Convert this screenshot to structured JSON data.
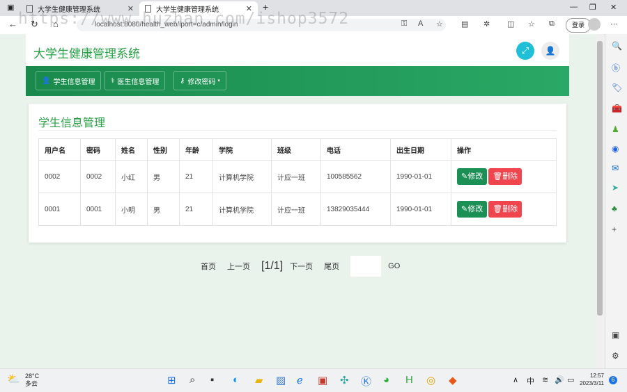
{
  "browser": {
    "tabs": [
      {
        "title": "大学生健康管理系统",
        "active": false
      },
      {
        "title": "大学生健康管理系统",
        "active": true
      }
    ],
    "new_tab": "+",
    "url": "localhost:8080/health_web/iport=c/admin/login",
    "login_label": "登录",
    "watermark": "https://www.huzhan.com/ishop3572"
  },
  "app": {
    "title": "大学生健康管理系统",
    "menu": [
      {
        "icon": "user-icon",
        "label": "学生信息管理"
      },
      {
        "icon": "doctor-icon",
        "label": "医生信息管理"
      },
      {
        "icon": "key-icon",
        "label": "修改密码"
      }
    ]
  },
  "main": {
    "section_title": "学生信息管理",
    "columns": [
      "用户名",
      "密码",
      "姓名",
      "性别",
      "年龄",
      "学院",
      "班级",
      "电话",
      "出生日期",
      "操作"
    ],
    "rows": [
      {
        "username": "0002",
        "password": "0002",
        "name": "小红",
        "gender": "男",
        "age": "21",
        "college": "计算机学院",
        "class": "计应一班",
        "phone": "100585562",
        "birth": "1990-01-01"
      },
      {
        "username": "0001",
        "password": "0001",
        "name": "小明",
        "gender": "男",
        "age": "21",
        "college": "计算机学院",
        "class": "计应一班",
        "phone": "13829035444",
        "birth": "1990-01-01"
      }
    ],
    "edit_label": "修改",
    "delete_label": "删除"
  },
  "pager": {
    "first": "首页",
    "prev": "上一页",
    "info": "[1/1]",
    "next": "下一页",
    "last": "尾页",
    "go": "GO"
  },
  "taskbar": {
    "temperature": "28°C",
    "weather": "多云",
    "ime": "中",
    "time": "12:57",
    "date": "2023/3/11",
    "notification_count": "6"
  },
  "colors": {
    "brand_green": "#26a045",
    "nav_green": "#1a8a4c",
    "edit_button": "#1c8f55",
    "delete_button": "#f0454d",
    "expand_button": "#1ebfd7"
  }
}
